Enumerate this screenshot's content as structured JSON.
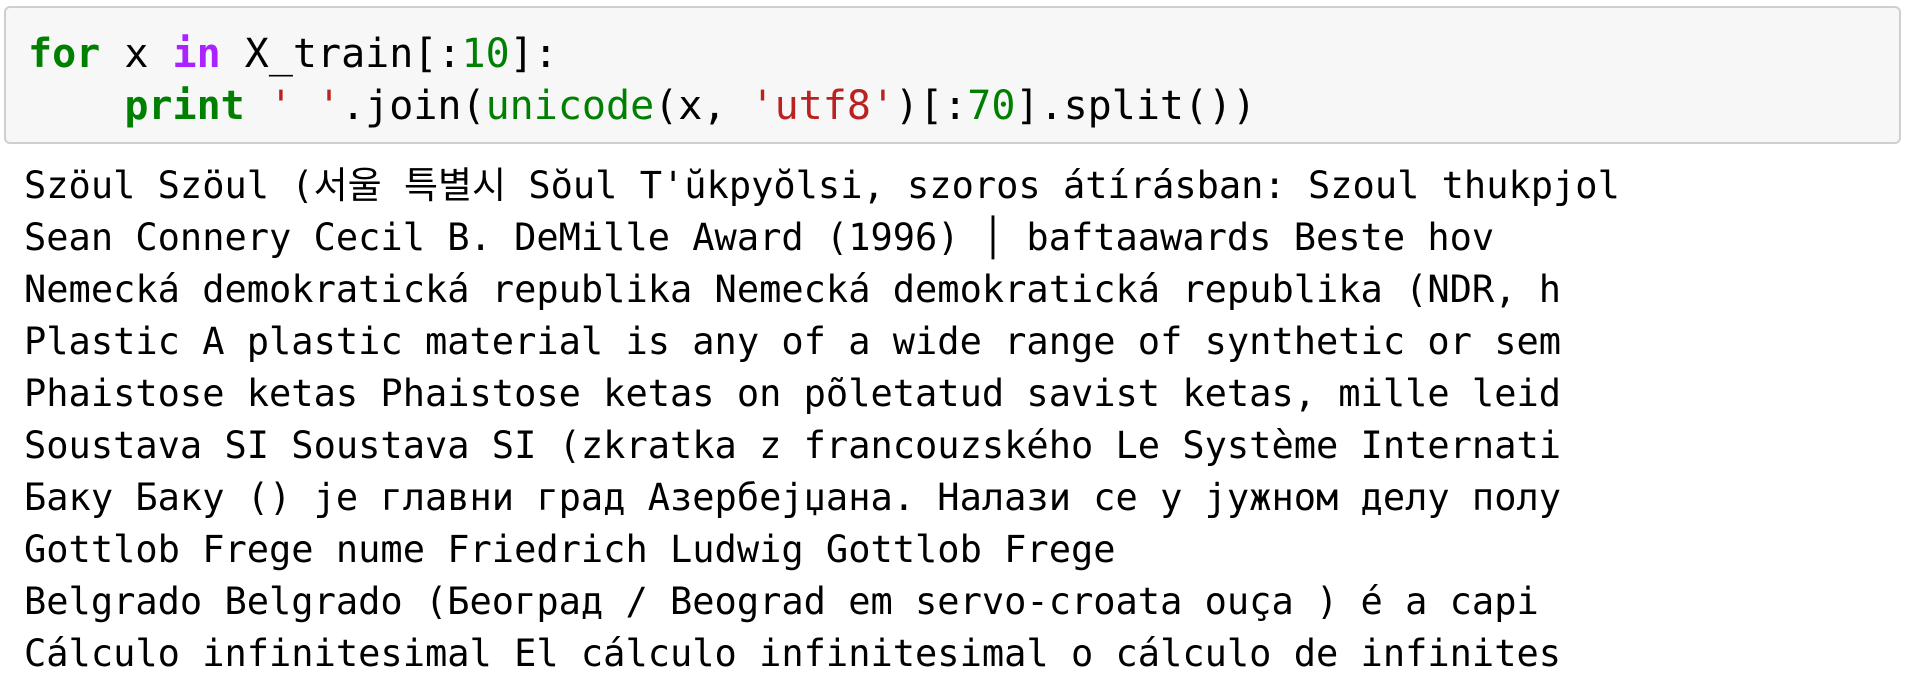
{
  "input": {
    "line1": {
      "kw_for": "for",
      "var": " x ",
      "kw_in": "in",
      "expr_start": " X_train[:",
      "num": "10",
      "expr_end": "]:"
    },
    "line2": {
      "indent": "    ",
      "kw_print": "print",
      "space": " ",
      "str1": "' '",
      "join": ".join(",
      "builtin": "unicode",
      "args_start": "(x, ",
      "str2": "'utf8'",
      "slice_start": ")[:",
      "num": "70",
      "tail": "].split())"
    }
  },
  "output": {
    "lines": [
      "Szöul Szöul (서울 특별시 Sŏul T'ŭkpyŏlsi, szoros átírásban: Szoul thukpjol",
      "Sean Connery Cecil B. DeMille Award (1996) │ baftaawards Beste hov",
      "Nemecká demokratická republika Nemecká demokratická republika (NDR, h",
      "Plastic A plastic material is any of a wide range of synthetic or sem",
      "Phaistose ketas Phaistose ketas on põletatud savist ketas, mille leid",
      "Soustava SI Soustava SI (zkratka z francouzského Le Système Internati",
      "Баку Баку () је главни град Азербејџана. Налази се у јужном делу полу",
      "Gottlob Frege nume Friedrich Ludwig Gottlob Frege",
      "Belgrado Belgrado (Београд / Beograd em servo-croata ouça ) é a capi",
      "Cálculo infinitesimal El cálculo infinitesimal o cálculo de infinites"
    ]
  },
  "colors": {
    "keyword": "#008000",
    "keyword_in": "#aa22ff",
    "number": "#008000",
    "string": "#ba2121",
    "input_bg": "#f7f7f7",
    "input_border": "#cfcfcf"
  }
}
